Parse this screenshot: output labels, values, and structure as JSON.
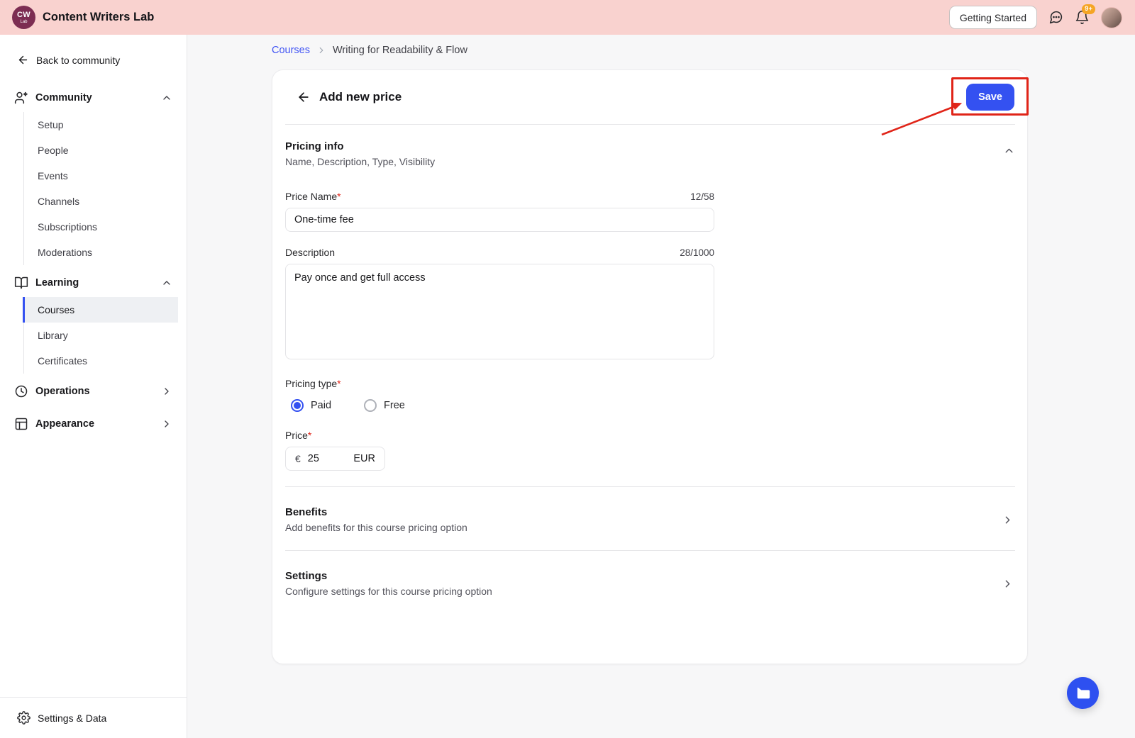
{
  "colors": {
    "accent": "#3451f1",
    "annotation": "#e02418",
    "topbar-bg": "#f9d2cf",
    "logo-bg": "#7c2d52",
    "badge-bg": "#f5a524"
  },
  "topbar": {
    "logo_line1": "CW",
    "logo_line2": "Lab",
    "brand": "Content Writers Lab",
    "getting_started_label": "Getting Started",
    "notification_badge": "9+"
  },
  "sidebar": {
    "back_link": "Back to community",
    "community": {
      "label": "Community",
      "items": [
        "Setup",
        "People",
        "Events",
        "Channels",
        "Subscriptions",
        "Moderations"
      ]
    },
    "learning": {
      "label": "Learning",
      "items": [
        "Courses",
        "Library",
        "Certificates"
      ],
      "selected": "Courses"
    },
    "operations_label": "Operations",
    "appearance_label": "Appearance",
    "footer_label": "Settings & Data"
  },
  "breadcrumb": {
    "root": "Courses",
    "current": "Writing for Readability & Flow"
  },
  "panel": {
    "title": "Add new price",
    "save_label": "Save",
    "pricing_info": {
      "title": "Pricing info",
      "subtitle": "Name, Description, Type, Visibility"
    },
    "price_name": {
      "label": "Price Name",
      "required_mark": "*",
      "counter": "12/58",
      "value": "One-time fee"
    },
    "description": {
      "label": "Description",
      "counter": "28/1000",
      "value": "Pay once and get full access"
    },
    "pricing_type": {
      "label": "Pricing type",
      "required_mark": "*",
      "option_paid": "Paid",
      "option_free": "Free",
      "selected": "Paid"
    },
    "price": {
      "label": "Price",
      "required_mark": "*",
      "currency_symbol": "€",
      "value": "25",
      "currency_code": "EUR"
    },
    "benefits": {
      "title": "Benefits",
      "subtitle": "Add benefits for this course pricing option"
    },
    "settings": {
      "title": "Settings",
      "subtitle": "Configure settings for this course pricing option"
    }
  }
}
